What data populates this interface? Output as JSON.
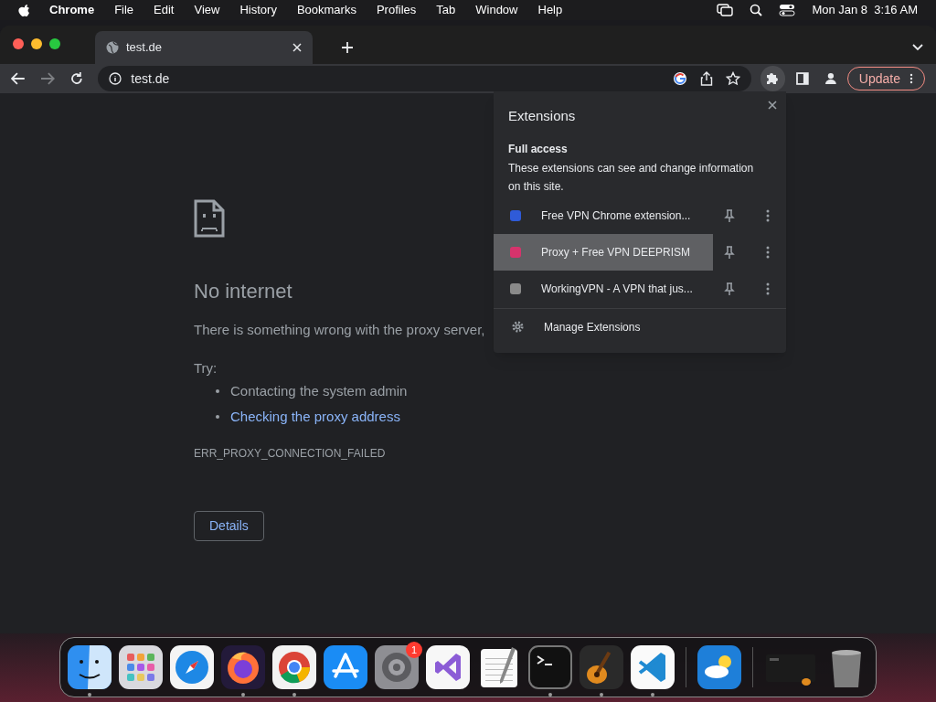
{
  "menu_bar": {
    "app": "Chrome",
    "items": [
      "File",
      "Edit",
      "View",
      "History",
      "Bookmarks",
      "Profiles",
      "Tab",
      "Window",
      "Help"
    ],
    "clock": "Mon Jan 8  3:16 AM"
  },
  "tabs": [
    {
      "title": "test.de",
      "selected": true
    }
  ],
  "address_bar": {
    "url": "test.de"
  },
  "update_button": "Update",
  "page": {
    "title": "No internet",
    "message": "There is something wrong with the proxy server,",
    "try_label": "Try:",
    "suggestions": [
      {
        "text": "Contacting the system admin",
        "kind": "plain"
      },
      {
        "text": "Checking the proxy address",
        "kind": "link"
      }
    ],
    "error_code": "ERR_PROXY_CONNECTION_FAILED",
    "details_button": "Details"
  },
  "extensions_popup": {
    "title": "Extensions",
    "section_title": "Full access",
    "section_description": "These extensions can see and change information on this site.",
    "items": [
      {
        "name": "Free VPN Chrome extension...",
        "color": "#2f5bd8",
        "highlighted": false
      },
      {
        "name": "Proxy + Free VPN DEEPRISM",
        "color": "#d6336c",
        "highlighted": true
      },
      {
        "name": "WorkingVPN - A VPN that jus...",
        "color": "#8a8a8a",
        "highlighted": false
      }
    ],
    "manage": "Manage Extensions"
  },
  "dock": [
    {
      "kind": "finder",
      "running": true
    },
    {
      "kind": "launchpad",
      "running": false
    },
    {
      "kind": "safari",
      "running": false
    },
    {
      "kind": "firefox",
      "running": true
    },
    {
      "kind": "chrome",
      "running": true
    },
    {
      "kind": "appstore",
      "running": false
    },
    {
      "kind": "settings",
      "running": false,
      "badge": "1"
    },
    {
      "kind": "visualstudio",
      "running": false
    },
    {
      "kind": "textedit",
      "running": false
    },
    {
      "kind": "terminal",
      "running": true
    },
    {
      "kind": "garageband",
      "running": true
    },
    {
      "kind": "vscode",
      "running": true
    },
    {
      "kind": "separator"
    },
    {
      "kind": "weather",
      "running": false
    },
    {
      "kind": "separator"
    },
    {
      "kind": "minimized",
      "running": false
    },
    {
      "kind": "trash",
      "running": false
    }
  ]
}
